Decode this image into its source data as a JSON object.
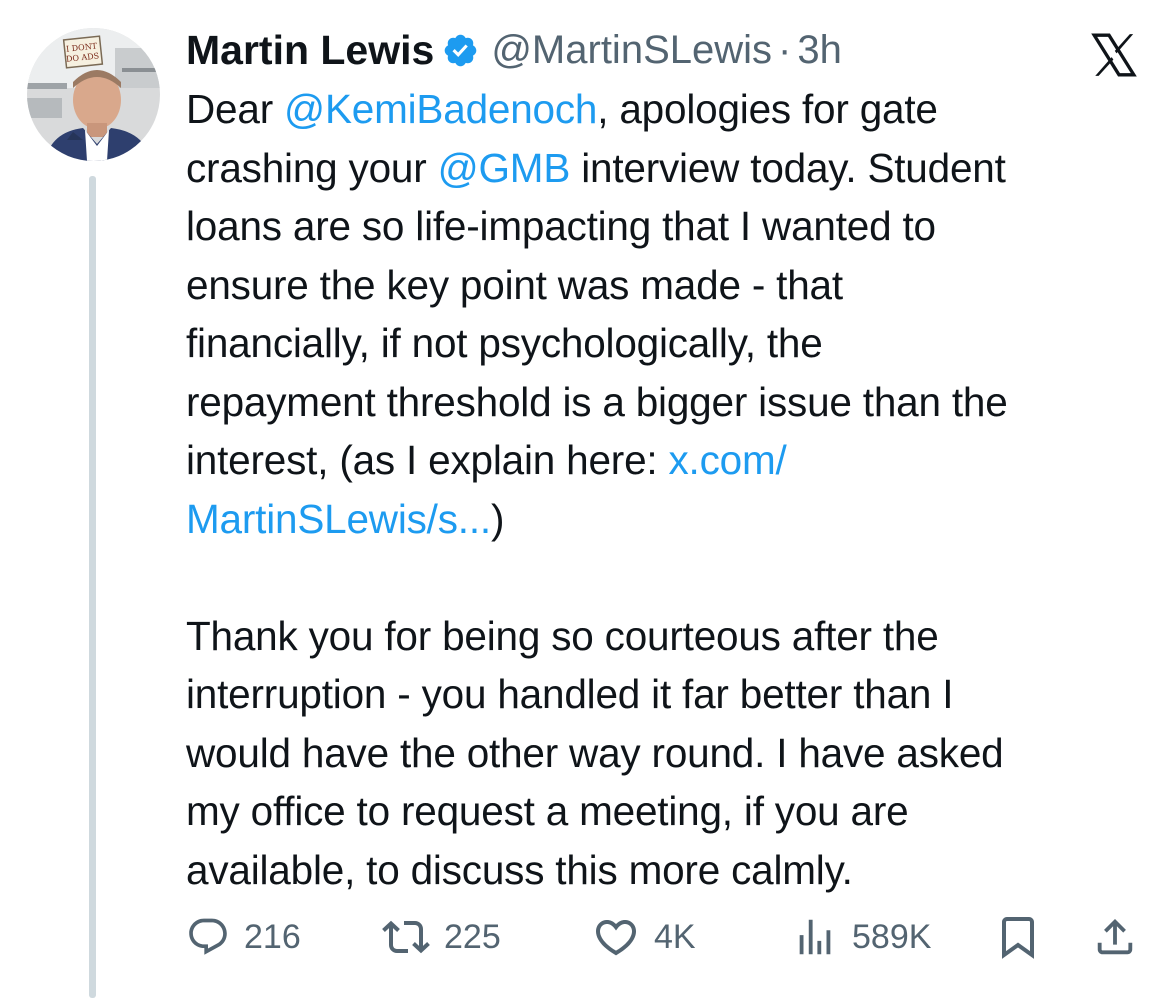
{
  "author": {
    "name": "Martin Lewis",
    "handle": "@MartinSLewis",
    "separator": "·",
    "time": "3h",
    "avatar_sign_text": "I DONT DO ADS"
  },
  "tweet": {
    "lines": [
      [
        {
          "text": "Dear "
        },
        {
          "text": "@KemiBadenoch",
          "link": true
        },
        {
          "text": ", apologies for gate"
        }
      ],
      [
        {
          "text": "crashing your "
        },
        {
          "text": "@GMB",
          "link": true
        },
        {
          "text": " interview today. Student"
        }
      ],
      [
        {
          "text": "loans are so life-impacting that I wanted to"
        }
      ],
      [
        {
          "text": "ensure the key point was made - that"
        }
      ],
      [
        {
          "text": "financially, if not psychologically, the"
        }
      ],
      [
        {
          "text": "repayment threshold is a bigger issue than the"
        }
      ],
      [
        {
          "text": "interest, (as I explain here: "
        },
        {
          "text": "x.com/",
          "link": true
        }
      ],
      [
        {
          "text": "MartinSLewis/s...",
          "link": true
        },
        {
          "text": ")"
        }
      ],
      [],
      [
        {
          "text": "Thank you for being so courteous after the"
        }
      ],
      [
        {
          "text": "interruption - you handled it far better than I"
        }
      ],
      [
        {
          "text": "would have the other way round. I have asked"
        }
      ],
      [
        {
          "text": "my office to request a meeting, if you are"
        }
      ],
      [
        {
          "text": "available, to discuss this more calmly."
        }
      ]
    ]
  },
  "actions": {
    "replies": "216",
    "reposts": "225",
    "likes": "4K",
    "views": "589K"
  },
  "colors": {
    "link": "#1d9bf0",
    "text": "#0f1419",
    "muted": "#536471",
    "verified": "#1d9bf0",
    "thread_line": "#cfd9de"
  },
  "icons": {
    "verified": "verified-badge-icon",
    "brand": "x-logo-icon",
    "reply": "reply-icon",
    "repost": "repost-icon",
    "like": "heart-icon",
    "views": "views-bar-chart-icon",
    "bookmark": "bookmark-icon",
    "share": "share-icon"
  }
}
